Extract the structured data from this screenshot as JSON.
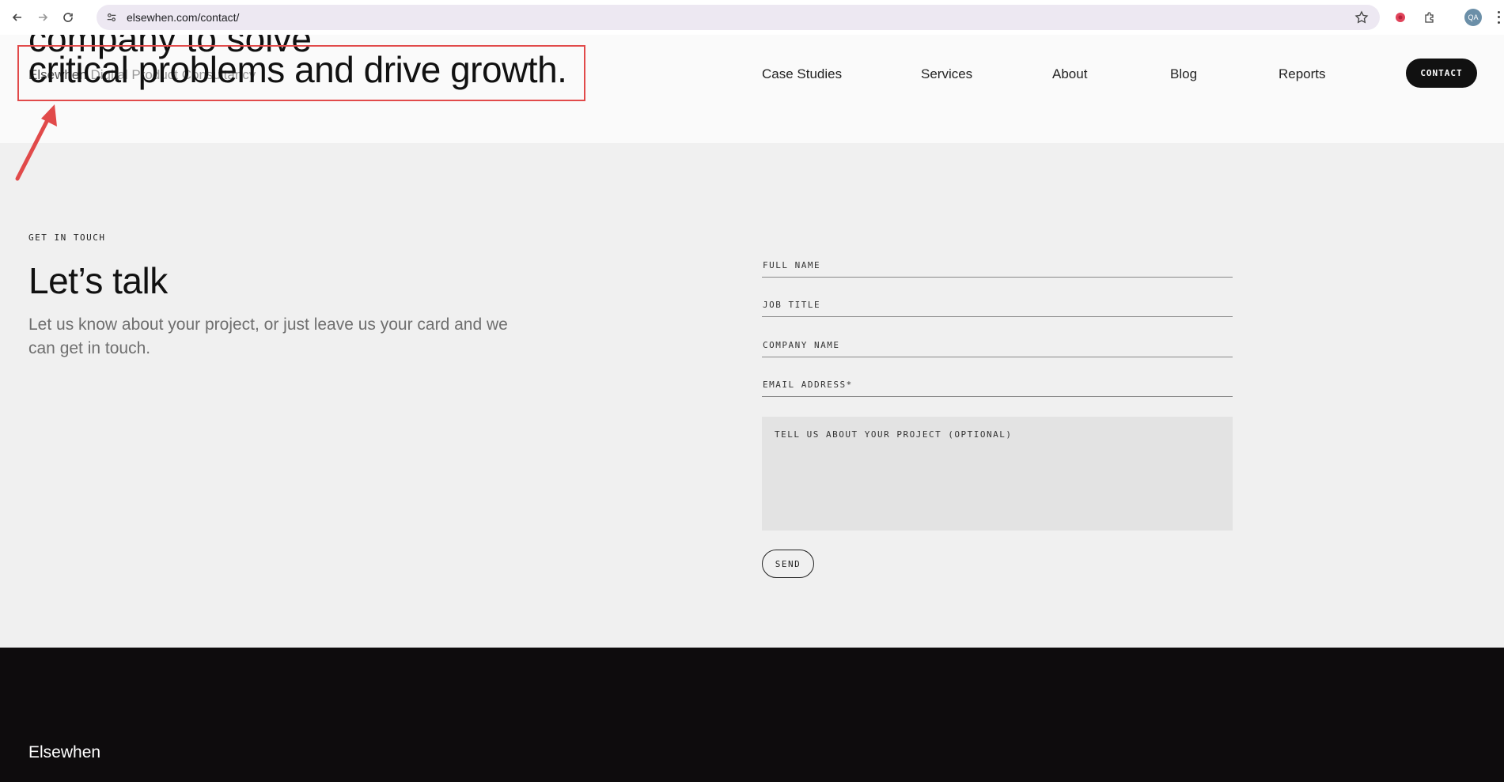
{
  "browser": {
    "url": "elsewhen.com/contact/",
    "profile_initials": "QA"
  },
  "header": {
    "peek_text": "company to solve",
    "hero_line": "critical problems and drive growth.",
    "brand": "Elsewhen",
    "brand_sub": "Digital Product Consultancy",
    "nav": [
      "Case Studies",
      "Services",
      "About",
      "Blog",
      "Reports"
    ],
    "contact_label": "CONTACT"
  },
  "contact": {
    "eyebrow": "GET IN TOUCH",
    "title": "Let’s talk",
    "lead": "Let us know about your project, or just leave us your card and we can get in touch."
  },
  "form": {
    "full_name": "FULL NAME",
    "job_title": "JOB TITLE",
    "company_name": "COMPANY NAME",
    "email": "EMAIL ADDRESS*",
    "project": "TELL US ABOUT YOUR PROJECT (OPTIONAL)",
    "send_label": "SEND"
  },
  "footer": {
    "brand": "Elsewhen"
  },
  "colors": {
    "annotation": "#e14a4a",
    "footer_bg": "#0e0c0d",
    "accent_dark": "#111111"
  }
}
